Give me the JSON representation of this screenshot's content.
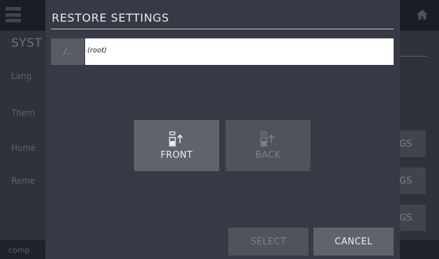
{
  "background": {
    "page_title": "SYST",
    "labels": [
      "Lang",
      "Them",
      "Home",
      "Reme"
    ],
    "buttons": [
      "GS",
      "GS",
      "GS"
    ],
    "status": "comp"
  },
  "dialog": {
    "title": "RESTORE SETTINGS",
    "up_label": "/..",
    "path": "(root)",
    "targets": [
      {
        "label": "FRONT",
        "enabled": true,
        "icon": "usb-upload-icon"
      },
      {
        "label": "BACK",
        "enabled": false,
        "icon": "usb-upload-icon"
      }
    ],
    "select_label": "SELECT",
    "cancel_label": "CANCEL"
  },
  "colors": {
    "panel": "#363a44",
    "button_enabled": "#5f636c",
    "button_disabled": "#4f535c",
    "text_enabled": "#eceef1",
    "text_disabled": "#7b8089"
  }
}
